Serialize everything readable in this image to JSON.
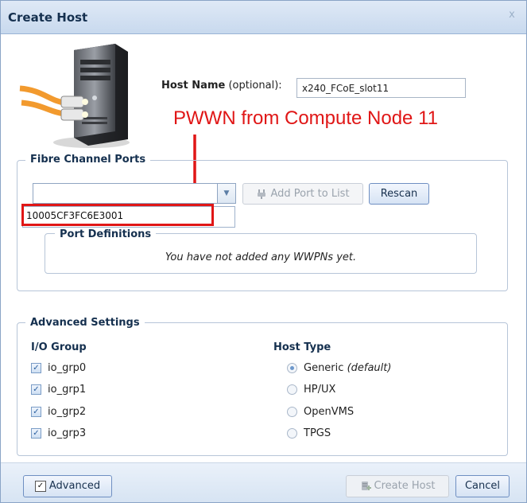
{
  "dialog": {
    "title": "Create Host",
    "close_glyph": "x"
  },
  "host": {
    "label_bold": "Host Name",
    "label_optional": " (optional):",
    "value": "x240_FCoE_slot11"
  },
  "annotation": {
    "text": "PWWN from Compute Node 11",
    "color": "#e01616"
  },
  "fibre_channel": {
    "legend": "Fibre Channel Ports",
    "combo_value": "",
    "dropdown_options": [
      "10005CF3FC6E3001"
    ],
    "add_port_label": "Add Port to List",
    "rescan_label": "Rescan",
    "port_definitions": {
      "legend": "Port Definitions",
      "empty_text": "You have not added any WWPNs yet."
    }
  },
  "advanced": {
    "legend": "Advanced Settings",
    "io_group": {
      "heading": "I/O Group",
      "items": [
        {
          "label": "io_grp0",
          "checked": true
        },
        {
          "label": "io_grp1",
          "checked": true
        },
        {
          "label": "io_grp2",
          "checked": true
        },
        {
          "label": "io_grp3",
          "checked": true
        }
      ]
    },
    "host_type": {
      "heading": "Host Type",
      "options": [
        {
          "label": "Generic",
          "suffix": "(default)",
          "selected": true
        },
        {
          "label": "HP/UX",
          "suffix": "",
          "selected": false
        },
        {
          "label": "OpenVMS",
          "suffix": "",
          "selected": false
        },
        {
          "label": "TPGS",
          "suffix": "",
          "selected": false
        }
      ]
    }
  },
  "footer": {
    "advanced_label": "Advanced",
    "advanced_checked": true,
    "create_host_label": "Create Host",
    "cancel_label": "Cancel"
  },
  "icons": {
    "server": "server-with-fibre-cable-icon",
    "add_port": "plug-icon",
    "create_host": "server-add-icon"
  }
}
